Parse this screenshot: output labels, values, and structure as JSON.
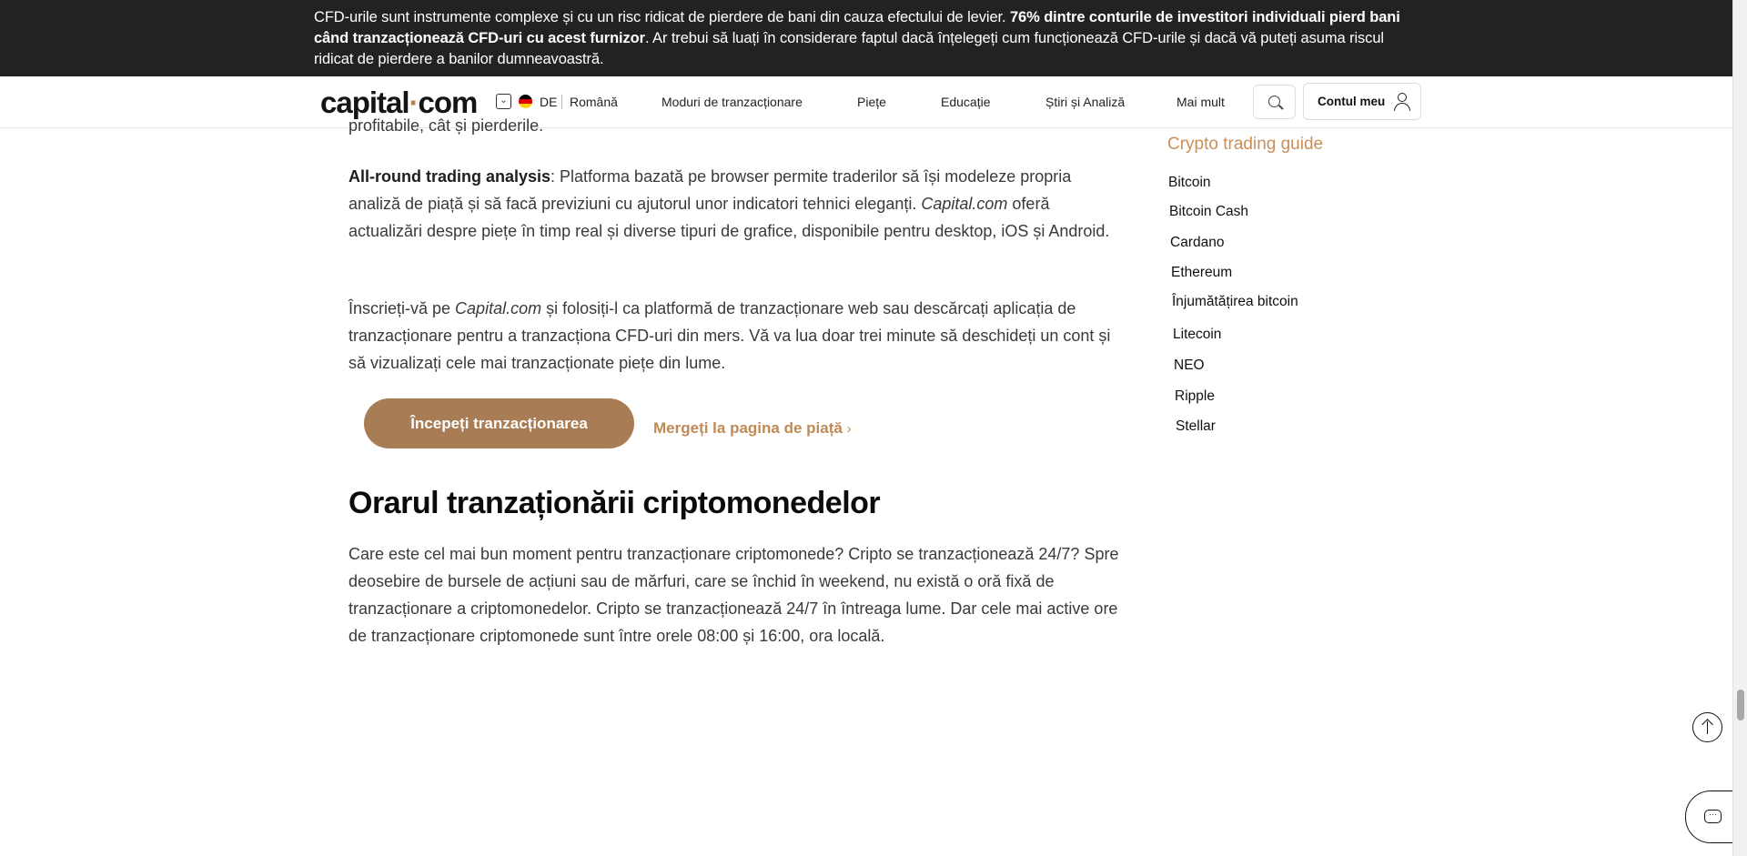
{
  "risk_banner": {
    "text_before": "CFD-urile sunt instrumente complexe și cu un risc ridicat de pierdere de bani din cauza efectului de levier. ",
    "text_bold": "76% dintre conturile de investitori individuali pierd bani când tranzacționează CFD-uri cu acest furnizor",
    "text_after": ". Ar trebui să luați în considerare faptul dacă înțelegeți cum funcționează CFD-urile și dacă vă puteți asuma riscul ridicat de pierdere a banilor dumneavoastră."
  },
  "header": {
    "logo_part1": "capital",
    "logo_dot": "·",
    "logo_part2": "com",
    "lang_icon": "chevron-down-icon",
    "lang_code": "DE",
    "lang_name": "Română",
    "nav": [
      "Moduri de tranzacționare",
      "Piețe",
      "Educație",
      "Știri și Analiză",
      "Mai mult"
    ],
    "account_label": "Contul meu"
  },
  "article": {
    "clipped_line": "profitabile, cât și pierderile.",
    "p1_bold": "All-round trading analysis",
    "p1_a": ": Platforma bazată pe browser permite traderilor să își modeleze propria analiză de piață și să facă previziuni cu ajutorul unor indicatori tehnici eleganți. ",
    "p1_italic": "Capital.com",
    "p1_b": " oferă actualizări despre piețe în timp real și diverse tipuri de grafice, disponibile pentru desktop, iOS și Android.",
    "p2_a": "Înscrieți-vă pe ",
    "p2_italic": "Capital.com",
    "p2_b": " și folosiți-l ca platformă de tranzacționare web sau descărcați aplicația de tranzacționare pentru a tranzacționa CFD-uri din mers. Vă va lua doar trei minute să deschideți un cont și să vizualizați cele mai tranzacționate piețe din lume.",
    "cta_label": "Începeți tranzacționarea",
    "market_link": "Mergeți la pagina de piață",
    "section_heading": "Orarul tranzaționării criptomonedelor",
    "p3": "Care este cel mai bun moment pentru tranzacționare criptomonede? Cripto se tranzacționează 24/7? Spre deosebire de bursele de acțiuni sau de mărfuri, care se închid în weekend, nu există o oră fixă de tranzacționare a criptomonedelor. Cripto se tranzacționează 24/7 în întreaga lume. Dar cele mai active ore de tranzacționare criptomonede sunt între orele 08:00 și 16:00, ora locală."
  },
  "sidebar": {
    "title": "Crypto trading guide",
    "items": [
      "Bitcoin",
      "Bitcoin Cash",
      "Cardano",
      "Ethereum",
      "Înjumătățirea bitcoin",
      "Litecoin",
      "NEO",
      "Ripple",
      "Stellar"
    ]
  },
  "colors": {
    "banner_bg": "#222222",
    "accent": "#a87d55",
    "link": "#c08a55",
    "sidebar_title": "#c98f58"
  }
}
